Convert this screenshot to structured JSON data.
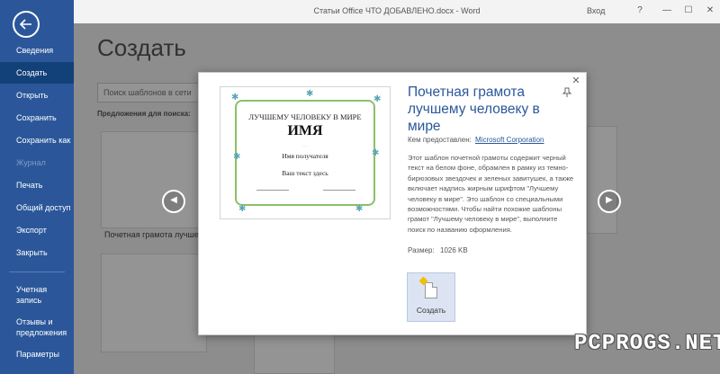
{
  "app": {
    "window_title": "Статьи Office ЧТО ДОБАВЛЕНО.docx  -  Word",
    "signin_label": "Вход",
    "help_label": "?",
    "minimize_label": "—",
    "maximize_label": "☐",
    "close_label": "✕"
  },
  "sidebar": {
    "items": [
      {
        "label": "Сведения"
      },
      {
        "label": "Создать"
      },
      {
        "label": "Открыть"
      },
      {
        "label": "Сохранить"
      },
      {
        "label": "Сохранить как"
      },
      {
        "label": "Журнал"
      },
      {
        "label": "Печать"
      },
      {
        "label": "Общий доступ"
      },
      {
        "label": "Экспорт"
      },
      {
        "label": "Закрыть"
      },
      {
        "label": "Учетная запись"
      },
      {
        "label": "Отзывы и предложения"
      },
      {
        "label": "Параметры"
      }
    ]
  },
  "backstage": {
    "heading": "Создать",
    "search_placeholder": "Поиск шаблонов в сети",
    "suggest_label": "Предложения для поиска:",
    "tile_caption": "Почетная грамота лучшему..."
  },
  "dialog": {
    "title": "Почетная грамота лучшему человеку в мире",
    "provider_label": "Кем предоставлен:",
    "provider_value": "Microsoft Corporation",
    "description": "Этот шаблон почетной грамоты содержит черный текст на белом фоне, обрамлен в рамку из темно-бирюзовых звездочек и зеленых завитушек, а также включает надпись жирным шрифтом \"Лучшему человеку в мире\". Это шаблон со специальными возможностями. Чтобы найти похожие шаблоны грамот \"Лучшему человеку в мире\", выполните поиск по названию оформления.",
    "size_label": "Размер:",
    "size_value": "1026 KB",
    "create_label": "Создать",
    "preview": {
      "line1": "ЛУЧШЕМУ ЧЕЛОВЕКУ В МИРЕ",
      "name": "ИМЯ",
      "recipient": "Имя получателя",
      "custom_text": "Ваш текст здесь"
    }
  },
  "watermark": "PCPROGS.NET",
  "colors": {
    "sidebar": "#2b579a",
    "sidebar_active": "#124078",
    "accent": "#2b579a"
  }
}
